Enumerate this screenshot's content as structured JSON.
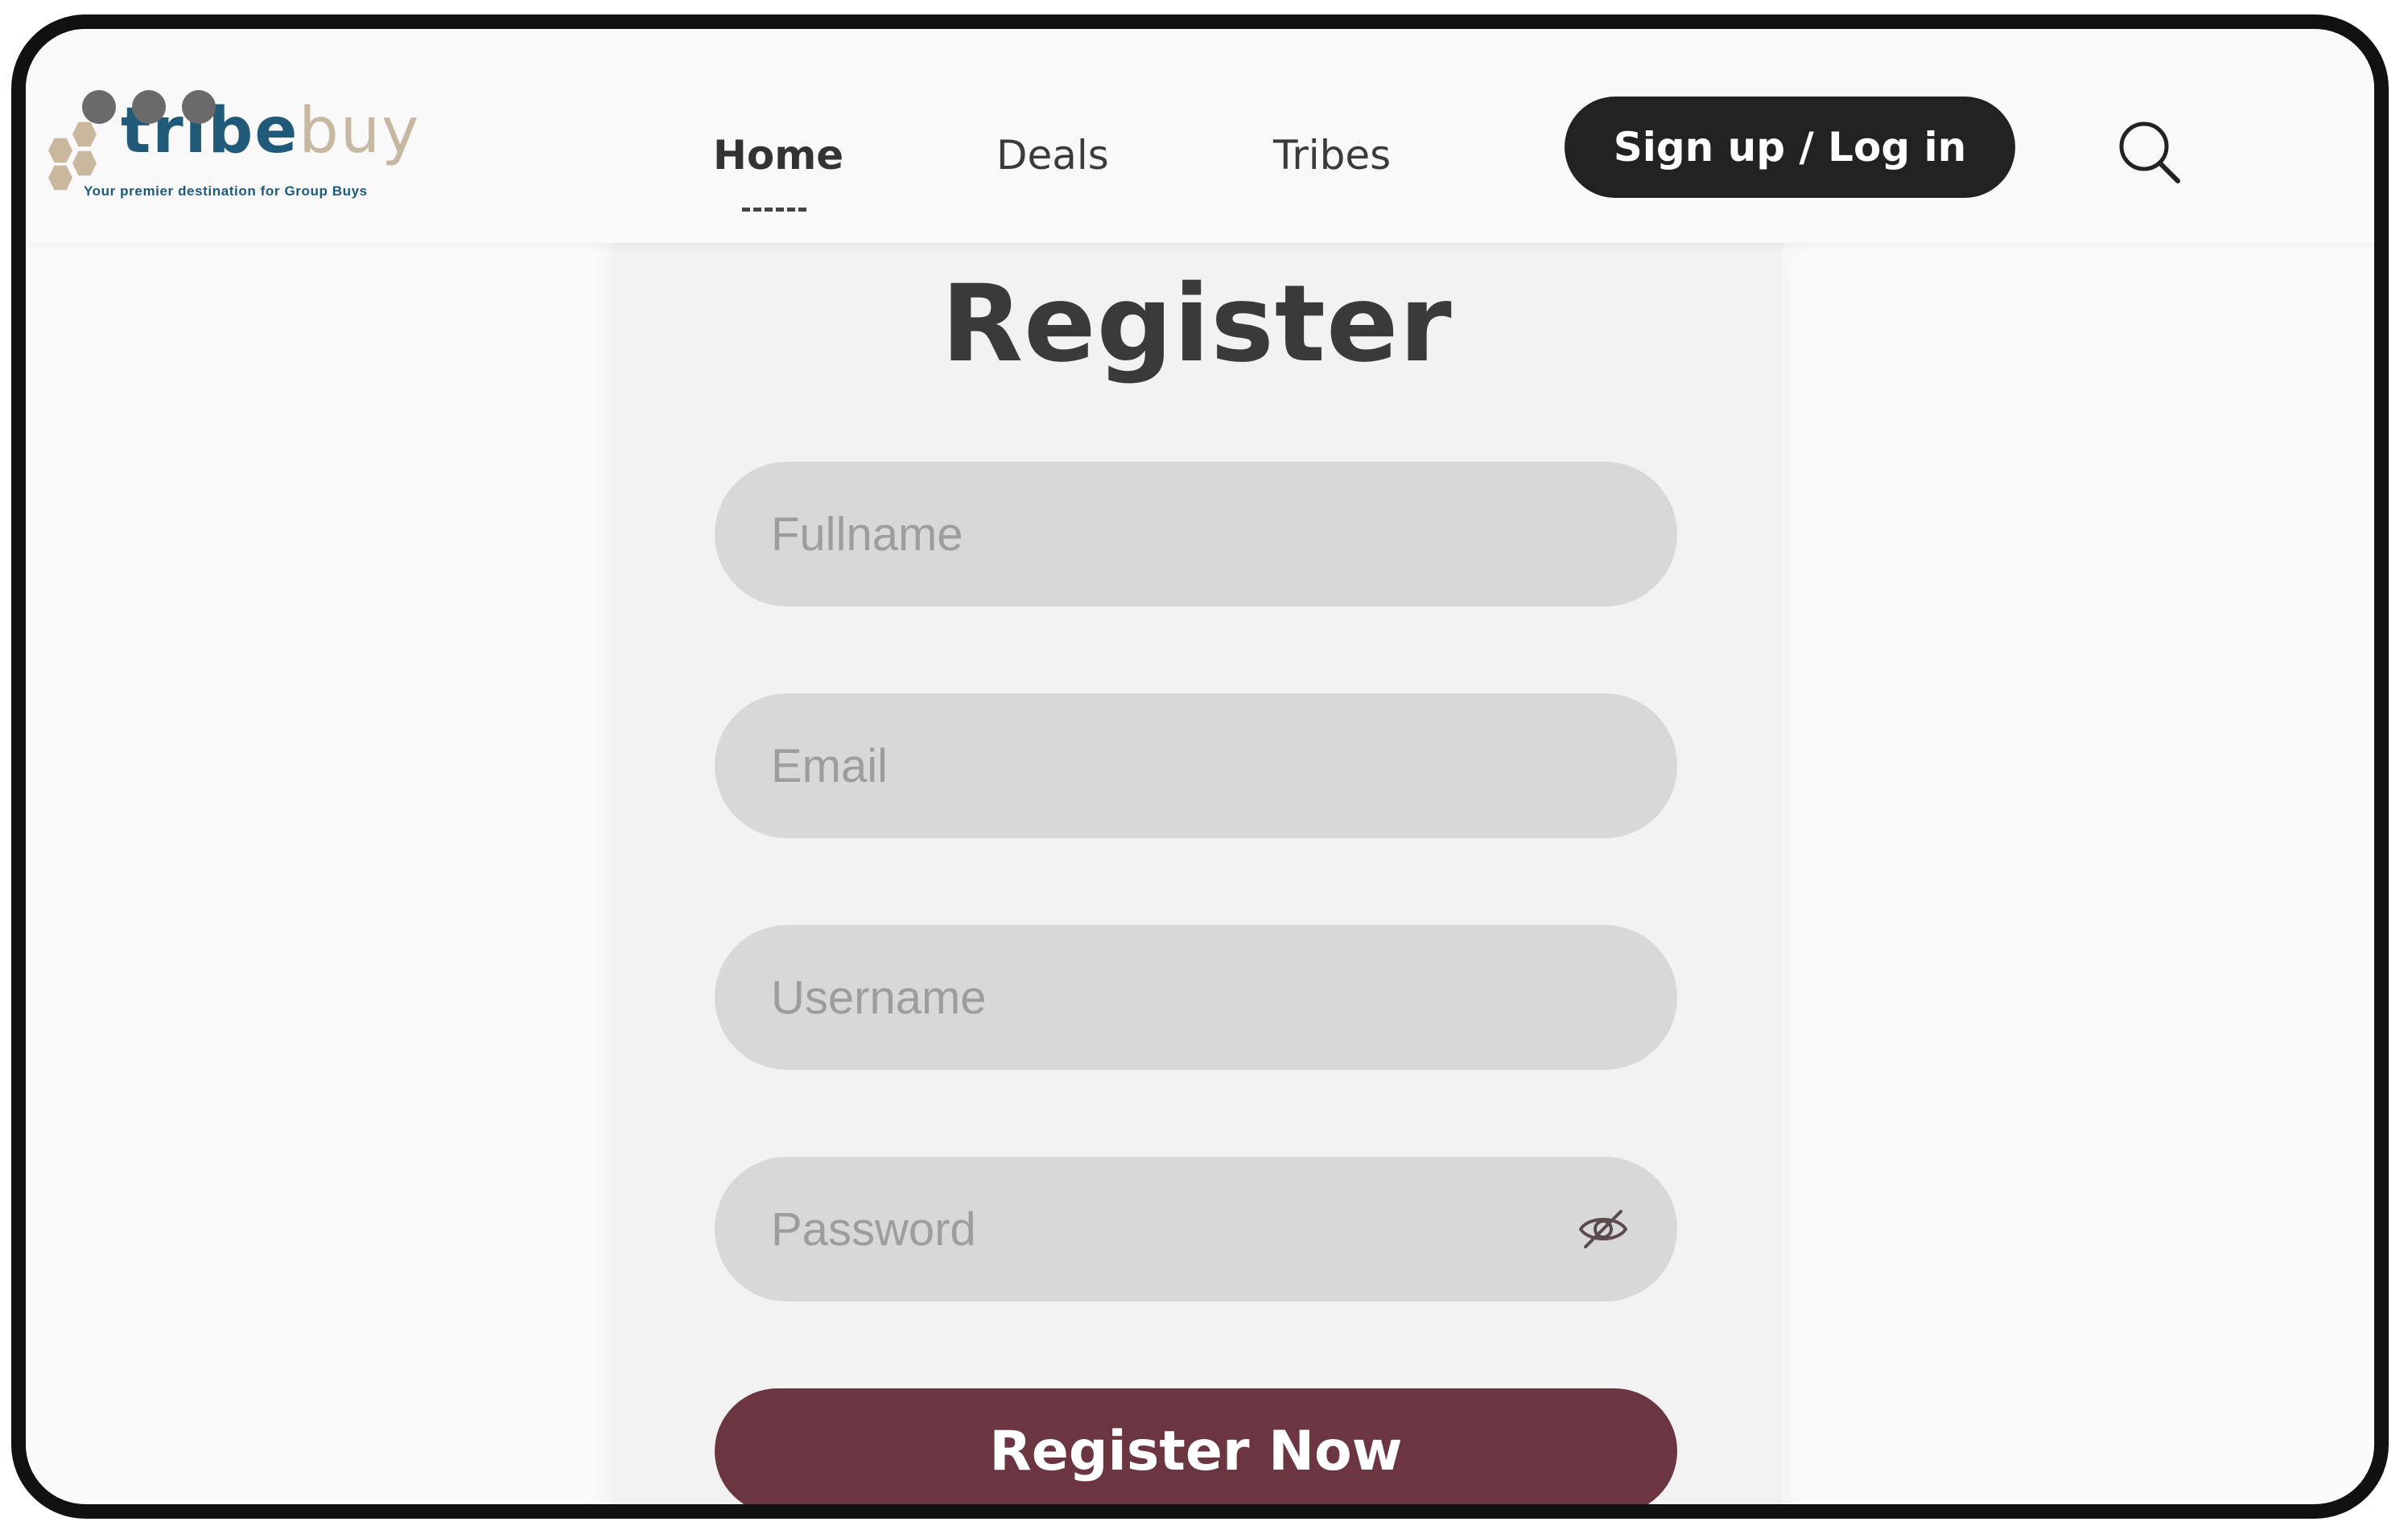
{
  "brand": {
    "name_part1": "tribe",
    "name_part2": "buy",
    "tagline": "Your premier destination for Group Buys"
  },
  "nav": {
    "items": [
      {
        "label": "Home",
        "active": true
      },
      {
        "label": "Deals",
        "active": false
      },
      {
        "label": "Tribes",
        "active": false
      }
    ],
    "signup_label": "Sign up / Log in"
  },
  "form": {
    "title": "Register",
    "fullname_placeholder": "Fullname",
    "email_placeholder": "Email",
    "username_placeholder": "Username",
    "password_placeholder": "Password",
    "submit_label": "Register Now"
  },
  "colors": {
    "brand_blue": "#215a79",
    "brand_tan": "#c7b8a1",
    "dark_button": "#222222",
    "accent": "#6b3541"
  }
}
